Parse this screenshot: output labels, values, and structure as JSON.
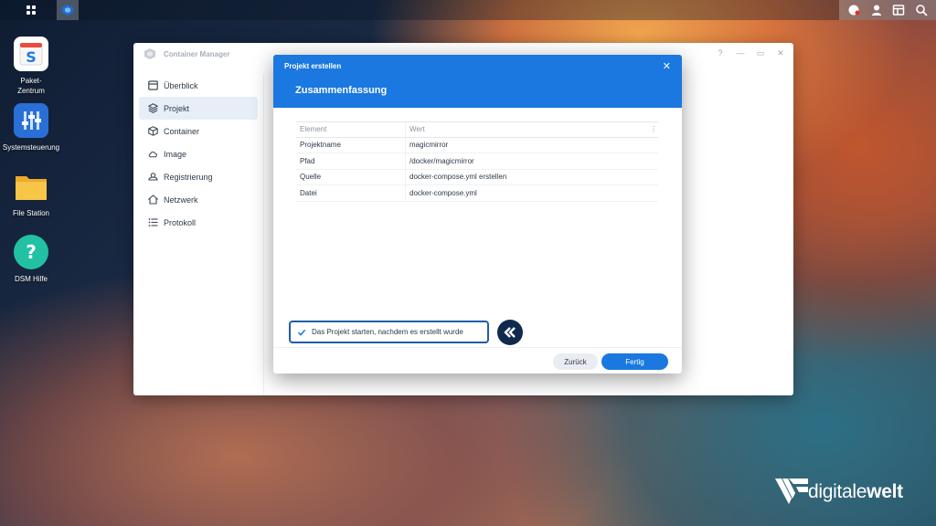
{
  "desktop": {
    "icons": [
      {
        "name": "package-center-icon",
        "label": "Paket-\nZentrum"
      },
      {
        "name": "control-panel-icon",
        "label": "Systemsteuerung"
      },
      {
        "name": "file-station-icon",
        "label": "File Station"
      },
      {
        "name": "dsm-help-icon",
        "label": "DSM Hilfe"
      }
    ]
  },
  "window": {
    "title": "Container Manager",
    "sidebar": [
      {
        "label": "Überblick",
        "icon": "overview-icon"
      },
      {
        "label": "Projekt",
        "icon": "project-icon",
        "active": true
      },
      {
        "label": "Container",
        "icon": "container-icon"
      },
      {
        "label": "Image",
        "icon": "cloud-icon"
      },
      {
        "label": "Registrierung",
        "icon": "registry-icon"
      },
      {
        "label": "Netzwerk",
        "icon": "network-icon"
      },
      {
        "label": "Protokoll",
        "icon": "log-icon"
      }
    ]
  },
  "dialog": {
    "title": "Projekt erstellen",
    "heading": "Zusammenfassung",
    "table": {
      "headers": [
        "Element",
        "Wert"
      ],
      "rows": [
        [
          "Projektname",
          "magicmirror"
        ],
        [
          "Pfad",
          "/docker/magicmirror"
        ],
        [
          "Quelle",
          "docker-compose.yml erstellen"
        ],
        [
          "Datei",
          "docker-compose.yml"
        ]
      ]
    },
    "checkbox_label": "Das Projekt starten, nachdem es erstellt wurde",
    "checkbox_checked": true,
    "cancel_label": "Zurück",
    "ok_label": "Fertig"
  },
  "brand": {
    "part1": "digitale",
    "part2": "welt"
  },
  "colors": {
    "accent": "#1a78e0",
    "highlight": "#1e5fa8"
  }
}
